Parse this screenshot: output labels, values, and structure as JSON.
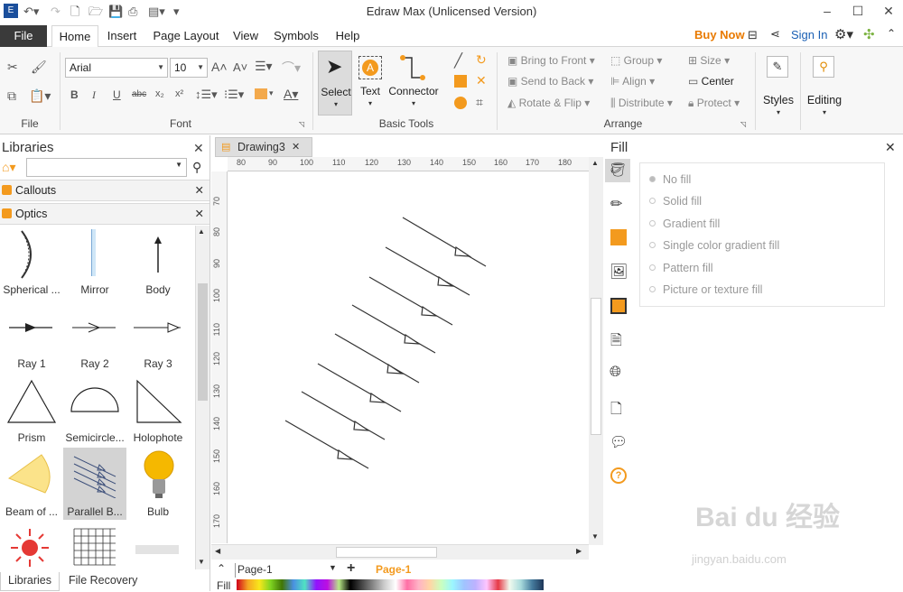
{
  "app": {
    "title": "Edraw Max (Unlicensed Version)"
  },
  "menu": {
    "file": "File",
    "tabs": [
      "Home",
      "Insert",
      "Page Layout",
      "View",
      "Symbols",
      "Help"
    ],
    "buy_now": "Buy Now",
    "sign_in": "Sign In"
  },
  "ribbon": {
    "file_group": "File",
    "font": {
      "family": "Arial",
      "size": "10",
      "group_label": "Font"
    },
    "basic_tools": {
      "select": "Select",
      "text": "Text",
      "connector": "Connector",
      "group_label": "Basic Tools"
    },
    "arrange": {
      "bring_to_front": "Bring to Front",
      "send_to_back": "Send to Back",
      "rotate_flip": "Rotate & Flip",
      "group": "Group",
      "align": "Align",
      "distribute": "Distribute",
      "size": "Size",
      "center": "Center",
      "protect": "Protect",
      "group_label": "Arrange"
    },
    "styles": "Styles",
    "editing": "Editing"
  },
  "libraries": {
    "title": "Libraries",
    "categories": [
      "Callouts",
      "Optics"
    ],
    "shapes": [
      {
        "label": "Spherical ..."
      },
      {
        "label": "Mirror"
      },
      {
        "label": "Body"
      },
      {
        "label": "Ray 1"
      },
      {
        "label": "Ray 2"
      },
      {
        "label": "Ray 3"
      },
      {
        "label": "Prism"
      },
      {
        "label": "Semicircle..."
      },
      {
        "label": "Holophote"
      },
      {
        "label": "Beam of ..."
      },
      {
        "label": "Parallel B..."
      },
      {
        "label": "Bulb"
      }
    ],
    "bottom_tabs": [
      "Libraries",
      "File Recovery"
    ]
  },
  "document": {
    "tab": "Drawing3",
    "ruler_top": [
      "80",
      "90",
      "100",
      "110",
      "120",
      "130",
      "140",
      "150",
      "160",
      "170",
      "180"
    ],
    "ruler_left": [
      "70",
      "80",
      "90",
      "100",
      "110",
      "120",
      "130",
      "140",
      "150",
      "160",
      "170"
    ],
    "page_selector": "Page-1",
    "active_page": "Page-1",
    "fill_label": "Fill"
  },
  "fill_panel": {
    "title": "Fill",
    "options": [
      "No fill",
      "Solid fill",
      "Gradient fill",
      "Single color gradient fill",
      "Pattern fill",
      "Picture or texture fill"
    ],
    "selected": "No fill"
  },
  "watermark": {
    "main": "Bai du 经验",
    "url": "jingyan.baidu.com"
  },
  "colors": {
    "accent": "#f39a1e",
    "dark_tab": "#3a3a3a",
    "link": "#1a5fb4",
    "buy": "#e97a00"
  }
}
